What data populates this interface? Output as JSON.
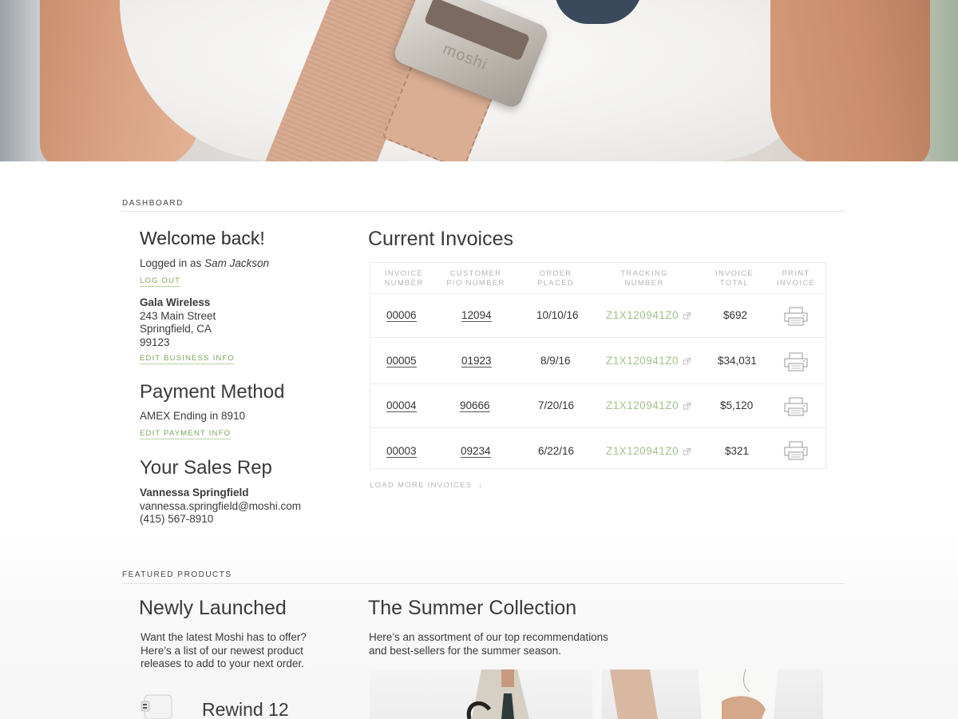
{
  "hero": {
    "image": "strap-shoulder-photo",
    "brand_text": "moshi"
  },
  "dashboard": {
    "section_label": "DASHBOARD",
    "welcome": "Welcome back!",
    "logged_in_prefix": "Logged in as ",
    "user_name": "Sam Jackson",
    "logout_label": "LOG OUT",
    "business": {
      "name": "Gala Wireless",
      "street": "243 Main Street",
      "city": "Springfield, CA",
      "zip": "99123",
      "edit_label": "EDIT BUSINESS INFO"
    },
    "payment": {
      "title": "Payment Method",
      "method": "AMEX Ending in 8910",
      "edit_label": "EDIT PAYMENT INFO"
    },
    "sales_rep": {
      "title": "Your Sales Rep",
      "name": "Vannessa Springfield",
      "email": "vannessa.springfield@moshi.com",
      "phone": "(415) 567-8910"
    }
  },
  "invoices": {
    "title": "Current Invoices",
    "headers": [
      [
        "INVOICE",
        "NUMBER"
      ],
      [
        "CUSTOMER",
        "P/O NUMBER"
      ],
      [
        "ORDER",
        "PLACED"
      ],
      [
        "TRACKING",
        "NUMBER"
      ],
      [
        "INVOICE",
        "TOTAL"
      ],
      [
        "PRINT",
        "INVOICE"
      ]
    ],
    "rows": [
      {
        "invoice": "00006",
        "po": "12094",
        "placed": "10/10/16",
        "tracking": "Z1X120941Z0",
        "total": "$692"
      },
      {
        "invoice": "00005",
        "po": "01923",
        "placed": "8/9/16",
        "tracking": "Z1X120941Z0",
        "total": "$34,031"
      },
      {
        "invoice": "00004",
        "po": "90666",
        "placed": "7/20/16",
        "tracking": "Z1X120941Z0",
        "total": "$5,120"
      },
      {
        "invoice": "00003",
        "po": "09234",
        "placed": "6/22/16",
        "tracking": "Z1X120941Z0",
        "total": "$321"
      }
    ],
    "load_more_label": "LOAD MORE INVOICES",
    "link_color": "#a2c389"
  },
  "featured": {
    "section_label": "FEATURED PRODUCTS",
    "newly_launched": {
      "title": "Newly Launched",
      "line1": "Want the latest Moshi has to offer?",
      "line2": "Here’s a list of our newest product",
      "line3": "releases to add to your next order.",
      "product_name": "Rewind 12"
    },
    "summer": {
      "title": "The Summer Collection",
      "line1": "Here’s an assortment of our top recommendations",
      "line2": "and best-sellers for the summer season."
    }
  },
  "accent_green": "#7aa65a"
}
